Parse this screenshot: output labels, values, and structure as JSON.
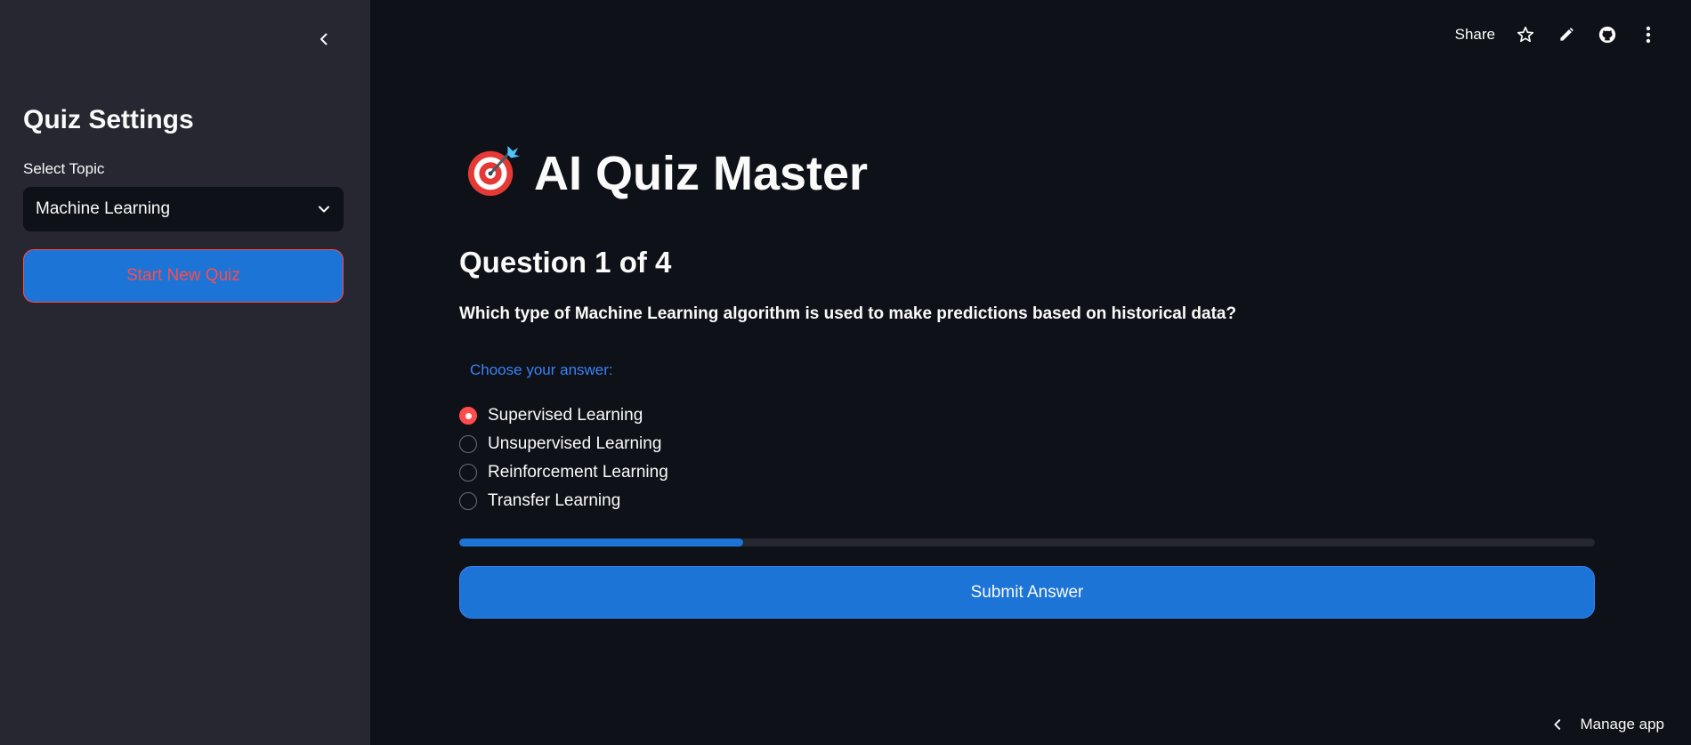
{
  "sidebar": {
    "title": "Quiz Settings",
    "topic_label": "Select Topic",
    "topic_value": "Machine Learning",
    "start_button": "Start New Quiz"
  },
  "toolbar": {
    "share_label": "Share",
    "icons": [
      "star-icon",
      "pencil-icon",
      "github-icon",
      "more-vertical-icon"
    ]
  },
  "main": {
    "title_emoji": "🎯",
    "title": "AI Quiz Master",
    "question_heading": "Question 1 of 4",
    "question_text": "Which type of Machine Learning algorithm is used to make predictions based on historical data?",
    "answer_label": "Choose your answer:",
    "options": [
      {
        "label": "Supervised Learning",
        "selected": true
      },
      {
        "label": "Unsupervised Learning",
        "selected": false
      },
      {
        "label": "Reinforcement Learning",
        "selected": false
      },
      {
        "label": "Transfer Learning",
        "selected": false
      }
    ],
    "progress_fraction": 0.25,
    "submit_label": "Submit Answer"
  },
  "footer": {
    "manage_label": "Manage app"
  },
  "colors": {
    "background": "#0e1117",
    "sidebar": "#262730",
    "accent_blue": "#1c74d6",
    "accent_red": "#ff4b4b"
  }
}
